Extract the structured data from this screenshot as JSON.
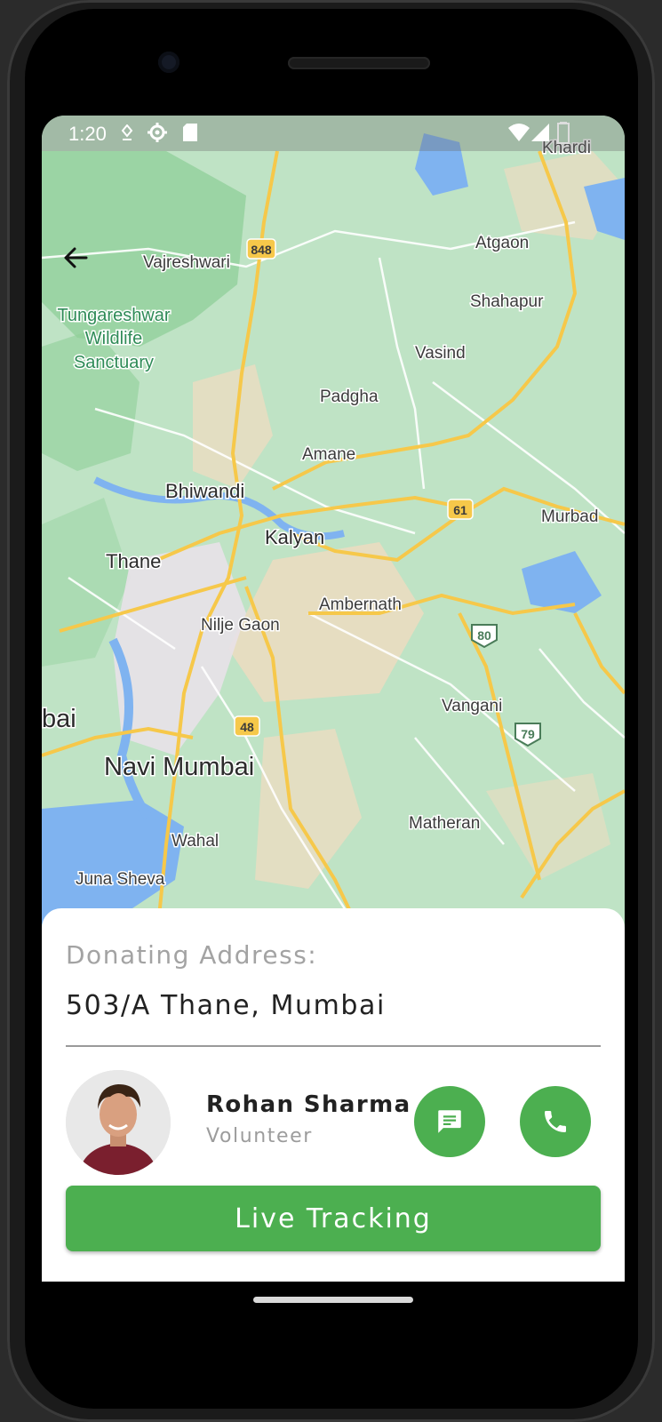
{
  "status_bar": {
    "time": "1:20"
  },
  "map": {
    "places": {
      "khardi": "Khardi",
      "vajreshwari": "Vajreshwari",
      "atgaon": "Atgaon",
      "tungareshwar_l1": "Tungareshwar",
      "tungareshwar_l2": "Wildlife",
      "tungareshwar_l3": "Sanctuary",
      "shahapur": "Shahapur",
      "vasind": "Vasind",
      "padgha": "Padgha",
      "amane": "Amane",
      "bhiwandi": "Bhiwandi",
      "murbad": "Murbad",
      "kalyan": "Kalyan",
      "thane": "Thane",
      "ambernath": "Ambernath",
      "nilje_gaon": "Nilje Gaon",
      "vangani": "Vangani",
      "bai": "bai",
      "navi_mumbai": "Navi Mumbai",
      "matheran": "Matheran",
      "wahal": "Wahal",
      "juna_sheva": "Juna Sheva"
    },
    "shields": {
      "r848": "848",
      "r61": "61",
      "r80": "80",
      "r48": "48",
      "r79": "79"
    }
  },
  "sheet": {
    "address_label": "Donating Address:",
    "address_value": "503/A Thane, Mumbai",
    "volunteer_name": "Rohan Sharma",
    "volunteer_role": "Volunteer",
    "track_button": "Live Tracking"
  },
  "colors": {
    "accent": "#4caf50",
    "map_green": "#bfe3c5",
    "road_yellow": "#f6c84a"
  }
}
